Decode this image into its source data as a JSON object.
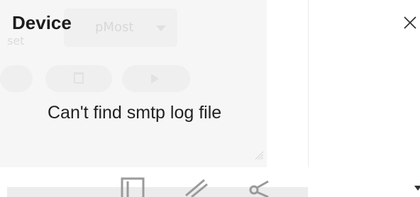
{
  "dialog": {
    "title": "Device",
    "message": "Can't find smtp log file",
    "close_icon": "close-icon"
  },
  "background": {
    "select_value": "pMost",
    "label": "set"
  }
}
